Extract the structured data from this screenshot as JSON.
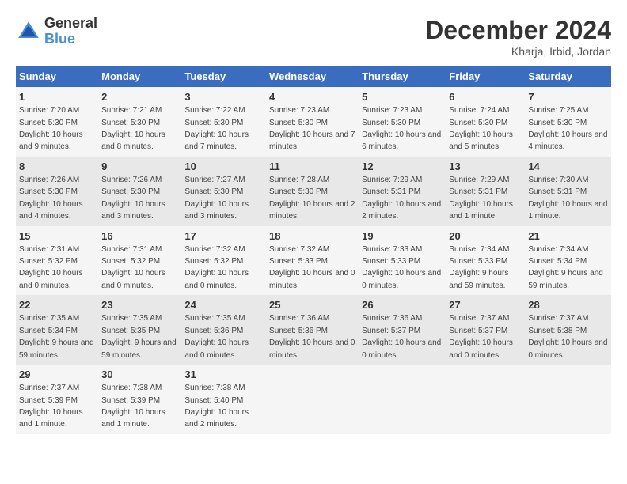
{
  "header": {
    "logo_line1": "General",
    "logo_line2": "Blue",
    "month_title": "December 2024",
    "location": "Kharja, Irbid, Jordan"
  },
  "days_of_week": [
    "Sunday",
    "Monday",
    "Tuesday",
    "Wednesday",
    "Thursday",
    "Friday",
    "Saturday"
  ],
  "weeks": [
    [
      {
        "day": "1",
        "sunrise": "7:20 AM",
        "sunset": "5:30 PM",
        "daylight": "10 hours and 9 minutes."
      },
      {
        "day": "2",
        "sunrise": "7:21 AM",
        "sunset": "5:30 PM",
        "daylight": "10 hours and 8 minutes."
      },
      {
        "day": "3",
        "sunrise": "7:22 AM",
        "sunset": "5:30 PM",
        "daylight": "10 hours and 7 minutes."
      },
      {
        "day": "4",
        "sunrise": "7:23 AM",
        "sunset": "5:30 PM",
        "daylight": "10 hours and 7 minutes."
      },
      {
        "day": "5",
        "sunrise": "7:23 AM",
        "sunset": "5:30 PM",
        "daylight": "10 hours and 6 minutes."
      },
      {
        "day": "6",
        "sunrise": "7:24 AM",
        "sunset": "5:30 PM",
        "daylight": "10 hours and 5 minutes."
      },
      {
        "day": "7",
        "sunrise": "7:25 AM",
        "sunset": "5:30 PM",
        "daylight": "10 hours and 4 minutes."
      }
    ],
    [
      {
        "day": "8",
        "sunrise": "7:26 AM",
        "sunset": "5:30 PM",
        "daylight": "10 hours and 4 minutes."
      },
      {
        "day": "9",
        "sunrise": "7:26 AM",
        "sunset": "5:30 PM",
        "daylight": "10 hours and 3 minutes."
      },
      {
        "day": "10",
        "sunrise": "7:27 AM",
        "sunset": "5:30 PM",
        "daylight": "10 hours and 3 minutes."
      },
      {
        "day": "11",
        "sunrise": "7:28 AM",
        "sunset": "5:30 PM",
        "daylight": "10 hours and 2 minutes."
      },
      {
        "day": "12",
        "sunrise": "7:29 AM",
        "sunset": "5:31 PM",
        "daylight": "10 hours and 2 minutes."
      },
      {
        "day": "13",
        "sunrise": "7:29 AM",
        "sunset": "5:31 PM",
        "daylight": "10 hours and 1 minute."
      },
      {
        "day": "14",
        "sunrise": "7:30 AM",
        "sunset": "5:31 PM",
        "daylight": "10 hours and 1 minute."
      }
    ],
    [
      {
        "day": "15",
        "sunrise": "7:31 AM",
        "sunset": "5:32 PM",
        "daylight": "10 hours and 0 minutes."
      },
      {
        "day": "16",
        "sunrise": "7:31 AM",
        "sunset": "5:32 PM",
        "daylight": "10 hours and 0 minutes."
      },
      {
        "day": "17",
        "sunrise": "7:32 AM",
        "sunset": "5:32 PM",
        "daylight": "10 hours and 0 minutes."
      },
      {
        "day": "18",
        "sunrise": "7:32 AM",
        "sunset": "5:33 PM",
        "daylight": "10 hours and 0 minutes."
      },
      {
        "day": "19",
        "sunrise": "7:33 AM",
        "sunset": "5:33 PM",
        "daylight": "10 hours and 0 minutes."
      },
      {
        "day": "20",
        "sunrise": "7:34 AM",
        "sunset": "5:33 PM",
        "daylight": "9 hours and 59 minutes."
      },
      {
        "day": "21",
        "sunrise": "7:34 AM",
        "sunset": "5:34 PM",
        "daylight": "9 hours and 59 minutes."
      }
    ],
    [
      {
        "day": "22",
        "sunrise": "7:35 AM",
        "sunset": "5:34 PM",
        "daylight": "9 hours and 59 minutes."
      },
      {
        "day": "23",
        "sunrise": "7:35 AM",
        "sunset": "5:35 PM",
        "daylight": "9 hours and 59 minutes."
      },
      {
        "day": "24",
        "sunrise": "7:35 AM",
        "sunset": "5:36 PM",
        "daylight": "10 hours and 0 minutes."
      },
      {
        "day": "25",
        "sunrise": "7:36 AM",
        "sunset": "5:36 PM",
        "daylight": "10 hours and 0 minutes."
      },
      {
        "day": "26",
        "sunrise": "7:36 AM",
        "sunset": "5:37 PM",
        "daylight": "10 hours and 0 minutes."
      },
      {
        "day": "27",
        "sunrise": "7:37 AM",
        "sunset": "5:37 PM",
        "daylight": "10 hours and 0 minutes."
      },
      {
        "day": "28",
        "sunrise": "7:37 AM",
        "sunset": "5:38 PM",
        "daylight": "10 hours and 0 minutes."
      }
    ],
    [
      {
        "day": "29",
        "sunrise": "7:37 AM",
        "sunset": "5:39 PM",
        "daylight": "10 hours and 1 minute."
      },
      {
        "day": "30",
        "sunrise": "7:38 AM",
        "sunset": "5:39 PM",
        "daylight": "10 hours and 1 minute."
      },
      {
        "day": "31",
        "sunrise": "7:38 AM",
        "sunset": "5:40 PM",
        "daylight": "10 hours and 2 minutes."
      },
      null,
      null,
      null,
      null
    ]
  ]
}
